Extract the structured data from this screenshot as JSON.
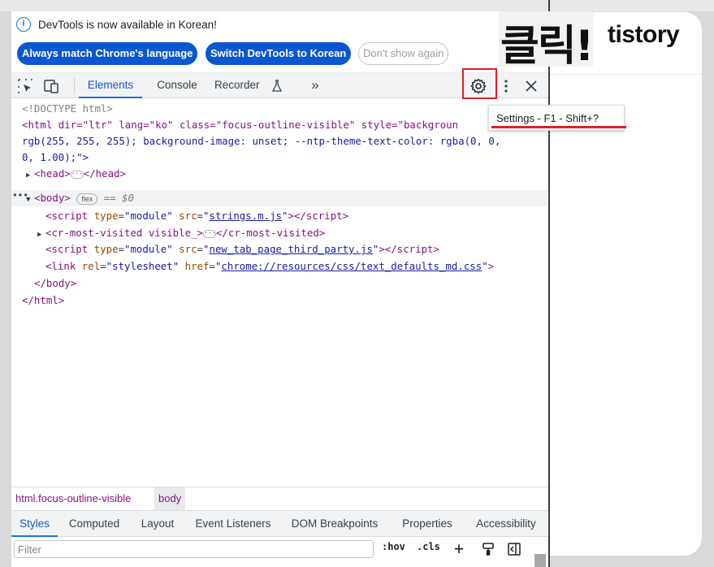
{
  "infobar": {
    "message": "DevTools is now available in Korean!",
    "buttons": [
      "Always match Chrome's language",
      "Switch DevTools to Korean",
      "Don't show again"
    ],
    "close": "×"
  },
  "toolbar": {
    "tabs": [
      "Elements",
      "Console",
      "Recorder",
      "»"
    ],
    "active_tab": "Elements",
    "settings_tooltip": "Settings - F1 - Shift+?"
  },
  "dom": {
    "doctype": "<!DOCTYPE html>",
    "html_open_1": "<html dir=\"ltr\" lang=\"ko\" class=\"focus-outline-visible\" style=\"backgroun",
    "html_open_2": "rgb(255, 255, 255); background-image: unset; --ntp-theme-text-color: rgba(0, 0,",
    "html_open_3": "0, 1.00);\">",
    "head": "<head>",
    "head_close": "</head>",
    "body": "<body>",
    "flex_badge": "flex",
    "dollar": "== $0",
    "script1_src": "strings.m.js",
    "cr_most_visited": "<cr-most-visited visible_>",
    "cr_close": "</cr-most-visited>",
    "script2_src": "new_tab_page_third_party.js",
    "link_href": "chrome://resources/css/text_defaults_md.css",
    "body_close": "</body>",
    "html_close": "</html>"
  },
  "breadcrumbs": [
    "html.focus-outline-visible",
    "body"
  ],
  "subtabs": [
    "Styles",
    "Computed",
    "Layout",
    "Event Listeners",
    "DOM Breakpoints",
    "Properties",
    "Accessibility"
  ],
  "filter": {
    "placeholder": "Filter",
    "hov": ":hov",
    "cls": ".cls",
    "plus": "+"
  },
  "page": {
    "logo_korean": "클릭!",
    "logo_brand": "tistory"
  },
  "colors": {
    "accent": "#1a73e8",
    "highlight_box": "#e0202a",
    "tag": "#881280",
    "attr": "#994500",
    "value": "#1a1aa6"
  }
}
